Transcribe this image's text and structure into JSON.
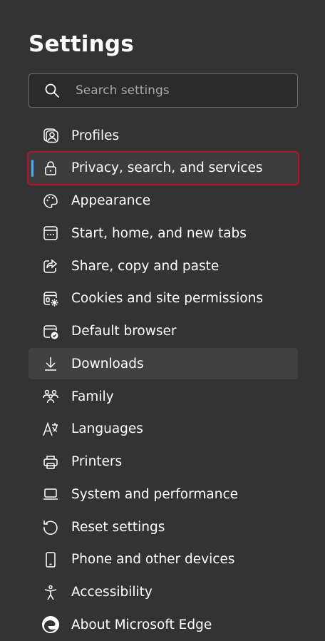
{
  "header": {
    "title": "Settings"
  },
  "search": {
    "placeholder": "Search settings",
    "icon": "search-icon"
  },
  "menu": {
    "items": [
      {
        "label": "Profiles",
        "icon": "profile-icon"
      },
      {
        "label": "Privacy, search, and services",
        "icon": "lock-icon",
        "selected": true
      },
      {
        "label": "Appearance",
        "icon": "palette-icon"
      },
      {
        "label": "Start, home, and new tabs",
        "icon": "home-tabs-icon"
      },
      {
        "label": "Share, copy and paste",
        "icon": "share-icon"
      },
      {
        "label": "Cookies and site permissions",
        "icon": "cookies-permissions-icon"
      },
      {
        "label": "Default browser",
        "icon": "default-browser-icon"
      },
      {
        "label": "Downloads",
        "icon": "download-icon",
        "hovered": true
      },
      {
        "label": "Family",
        "icon": "family-icon"
      },
      {
        "label": "Languages",
        "icon": "languages-icon"
      },
      {
        "label": "Printers",
        "icon": "printer-icon"
      },
      {
        "label": "System and performance",
        "icon": "laptop-icon"
      },
      {
        "label": "Reset settings",
        "icon": "reset-icon"
      },
      {
        "label": "Phone and other devices",
        "icon": "phone-icon"
      },
      {
        "label": "Accessibility",
        "icon": "accessibility-icon"
      },
      {
        "label": "About Microsoft Edge",
        "icon": "edge-logo-icon"
      }
    ]
  },
  "colors": {
    "background": "#333333",
    "selected_accent": "#5fa8e6",
    "selected_outline": "#b5162b",
    "hover_background": "#414141"
  }
}
